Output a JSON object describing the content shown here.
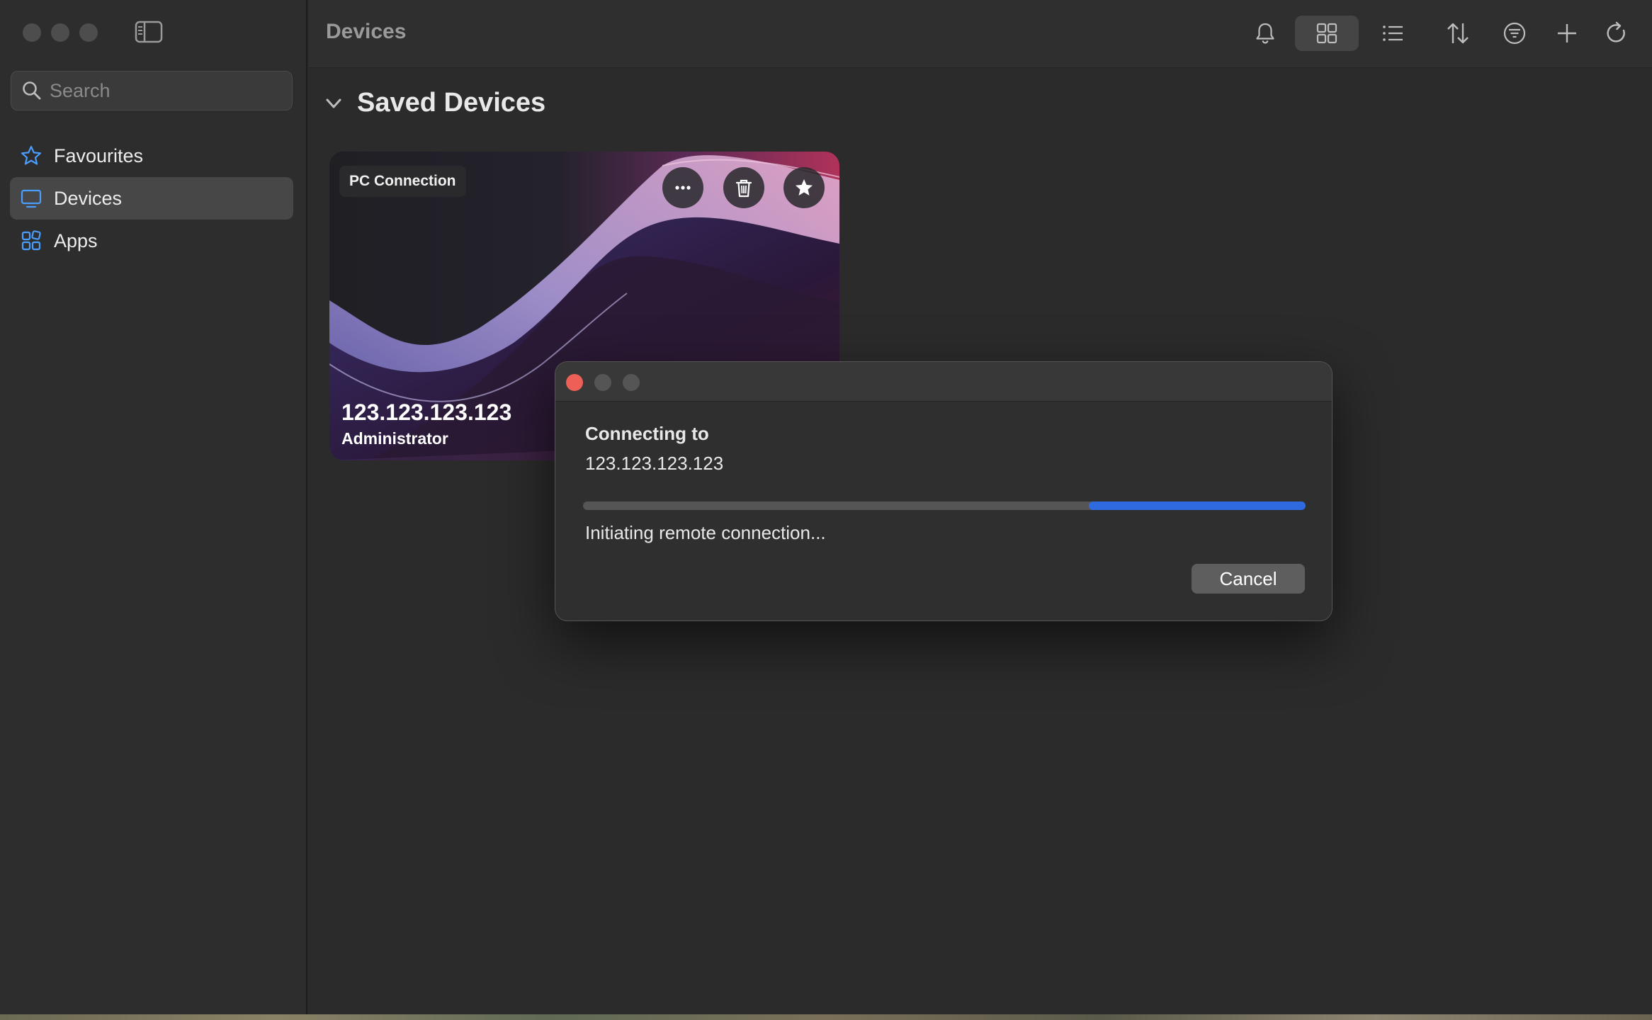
{
  "window": {
    "title": "Devices"
  },
  "sidebar": {
    "search_placeholder": "Search",
    "items": [
      {
        "label": "Favourites",
        "icon": "star-icon",
        "active": false
      },
      {
        "label": "Devices",
        "icon": "monitor-icon",
        "active": true
      },
      {
        "label": "Apps",
        "icon": "apps-grid-icon",
        "active": false
      }
    ]
  },
  "toolbar": {
    "icons": [
      "bell-icon",
      "grid-view-icon",
      "list-view-icon",
      "sort-icon",
      "filter-icon",
      "plus-icon",
      "refresh-icon"
    ],
    "active_view": "grid"
  },
  "main": {
    "section_title": "Saved Devices",
    "card": {
      "badge": "PC Connection",
      "ip": "123.123.123.123",
      "user": "Administrator",
      "actions": [
        "more-icon",
        "trash-icon",
        "star-icon"
      ]
    }
  },
  "dialog": {
    "heading": "Connecting to",
    "target": "123.123.123.123",
    "status": "Initiating remote connection...",
    "cancel_label": "Cancel",
    "progress_indeterminate_segment": {
      "start": 0.7,
      "end": 1.0
    }
  },
  "colors": {
    "accent": "#2f6ae0",
    "sidebar_icon": "#4a9eff",
    "close_red": "#ed5f57"
  }
}
